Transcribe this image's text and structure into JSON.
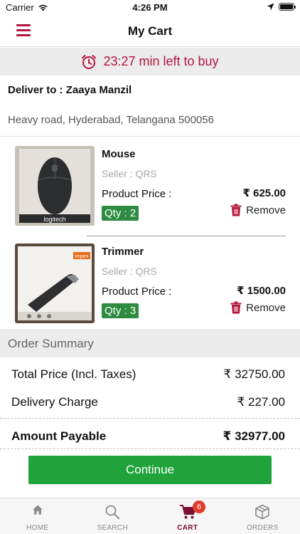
{
  "status_bar": {
    "carrier": "Carrier",
    "time": "4:26 PM"
  },
  "header": {
    "title": "My Cart"
  },
  "timer": {
    "text": "23:27 min left to buy"
  },
  "delivery": {
    "label": "Deliver to : Zaaya Manzil",
    "address": "Heavy road,   Hyderabad, Telangana 500056"
  },
  "products": [
    {
      "name": "Mouse",
      "seller": "Seller : QRS",
      "price_label": "Product Price :",
      "price": "₹ 625.00",
      "qty": "Qty : 2",
      "remove_label": "Remove",
      "image_brand": "logitech"
    },
    {
      "name": "Trimmer",
      "seller": "Seller : QRS",
      "price_label": "Product Price :",
      "price": "₹ 1500.00",
      "qty": "Qty : 3",
      "remove_label": "Remove",
      "image_brand": "impex"
    }
  ],
  "summary": {
    "title": "Order Summary",
    "total_label": "Total Price (Incl. Taxes)",
    "total_value": "₹ 32750.00",
    "delivery_label": "Delivery Charge",
    "delivery_value": "₹ 227.00",
    "payable_label": "Amount Payable",
    "payable_value": "₹ 32977.00"
  },
  "continue_label": "Continue",
  "tabs": [
    {
      "label": "HOME",
      "icon": "home-icon",
      "active": false
    },
    {
      "label": "SEARCH",
      "icon": "search-icon",
      "active": false
    },
    {
      "label": "CART",
      "icon": "cart-icon",
      "active": true,
      "badge": "6"
    },
    {
      "label": "ORDERS",
      "icon": "box-icon",
      "active": false
    }
  ],
  "colors": {
    "accent": "#b3153b",
    "qty_green": "#2e8b3f",
    "continue_green": "#21a33b",
    "active_tab": "#7a1132",
    "badge_red": "#e33b2c"
  }
}
